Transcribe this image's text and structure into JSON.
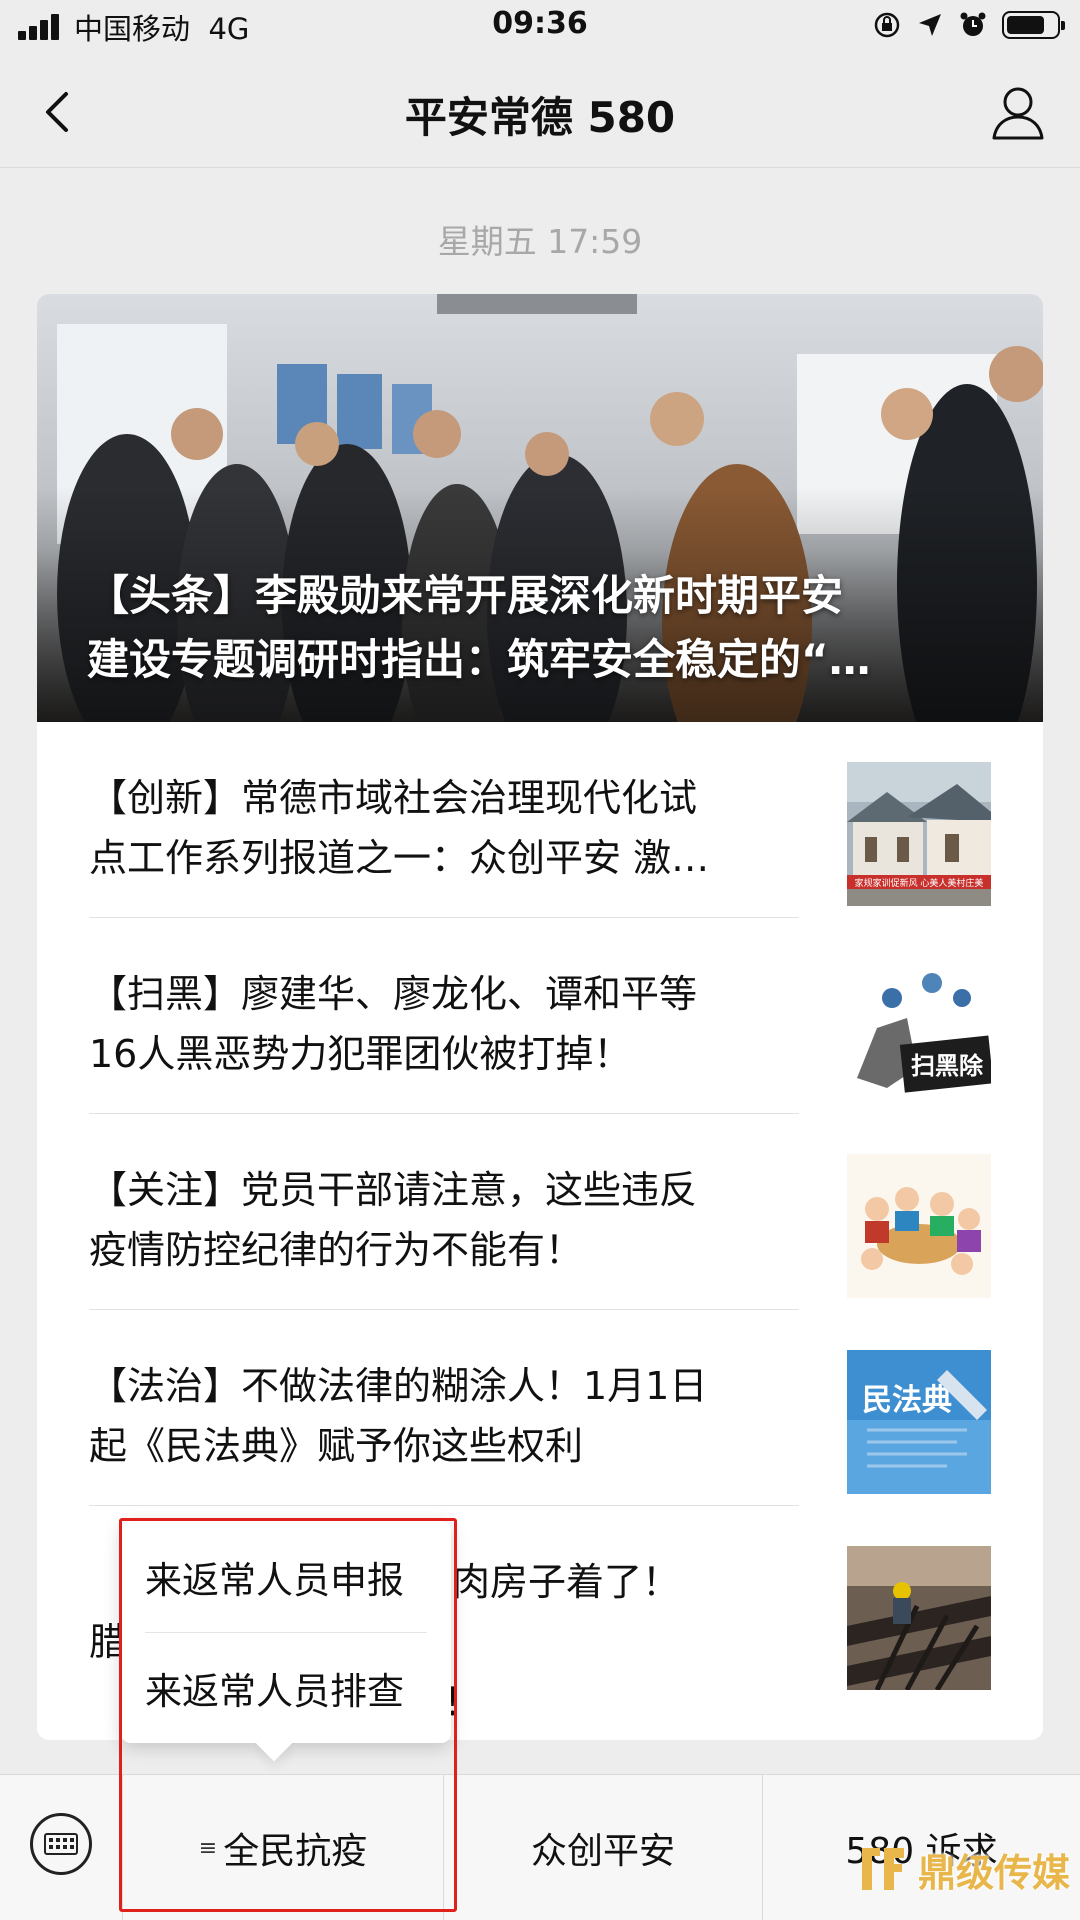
{
  "status_bar": {
    "carrier": "中国移动",
    "network": "4G",
    "time": "09:36"
  },
  "nav": {
    "title": "平安常德 580"
  },
  "timestamp": "星期五 17:59",
  "headline": {
    "line1": "【头条】李殿勋来常开展深化新时期平安",
    "line2": "建设专题调研时指出：筑牢安全稳定的“…"
  },
  "articles": [
    {
      "line1": "【创新】常德市域社会治理现代化试",
      "line2": "点工作系列报道之一：众创平安 激…",
      "thumb_caption": "家规家训促新风 心美人美村庄美"
    },
    {
      "line1": "【扫黑】廖建华、廖龙化、谭和平等",
      "line2": "16人黑恶势力犯罪团伙被打掉！",
      "thumb_caption": "扫黑除"
    },
    {
      "line1": "【关注】党员干部请注意，这些违反",
      "line2": "疫情防控纪律的行为不能有！",
      "thumb_caption": ""
    },
    {
      "line1": "【法治】不做法律的糊涂人！1月1日",
      "line2": "起《民法典》赋予你这些权利",
      "thumb_caption": "民法典"
    },
    {
      "line1": "腊肉房子着了！",
      "line2": "腊",
      "line2b": "要防！",
      "thumb_caption": ""
    }
  ],
  "popup_menu": {
    "items": [
      "来返常人员申报",
      "来返常人员排查"
    ]
  },
  "bottom_menu": {
    "tabs": [
      "全民抗疫",
      "众创平安",
      "580 诉求"
    ]
  },
  "watermark": {
    "text": "鼎级传媒"
  },
  "colors": {
    "highlight_border": "#e0201b",
    "background": "#ededed",
    "watermark": "#e8b64a"
  }
}
